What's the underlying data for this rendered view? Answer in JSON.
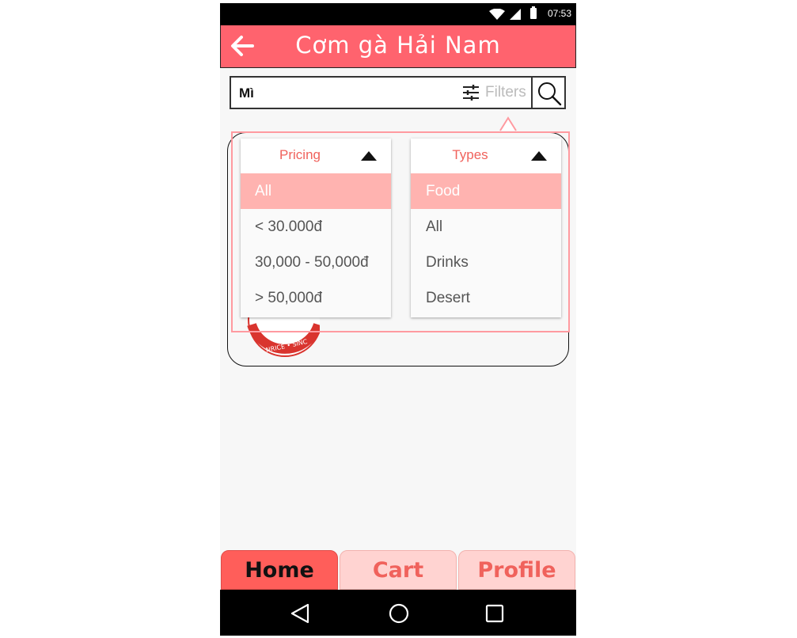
{
  "status_bar": {
    "time": "07:53"
  },
  "header": {
    "title": "Cơm gà Hải Nam"
  },
  "search": {
    "query": "Mì",
    "filters_label": "Filters"
  },
  "filters": {
    "pricing": {
      "label": "Pricing",
      "options": [
        "All",
        "< 30.000đ",
        "30,000 - 50,000đ",
        "> 50,000đ"
      ],
      "selected": "All"
    },
    "types": {
      "label": "Types",
      "options": [
        "Food",
        "All",
        "Drinks",
        "Desert"
      ],
      "selected": "Food"
    }
  },
  "tabs": {
    "home": "Home",
    "cart": "Cart",
    "profile": "Profile",
    "active": "Home"
  },
  "colors": {
    "accent": "#ff636e",
    "selected_option": "#ffb3b0",
    "tab_active": "#ff5e5a",
    "tab_inactive": "#ffd3d1"
  }
}
